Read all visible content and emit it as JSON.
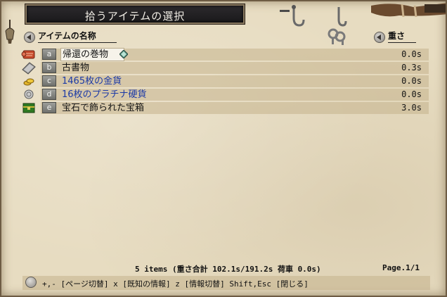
{
  "window": {
    "title": "拾うアイテムの選択"
  },
  "header": {
    "name_label": "アイテムの名称",
    "weight_label": "重さ"
  },
  "items": [
    {
      "key": "a",
      "name": "帰還の巻物",
      "weight": "0.0s",
      "color": "#141414",
      "icon": "scroll-icon",
      "selected": true
    },
    {
      "key": "b",
      "name": "古書物",
      "weight": "0.3s",
      "color": "#141414",
      "icon": "book-icon",
      "selected": false
    },
    {
      "key": "c",
      "name": "1465枚の金貨",
      "weight": "0.0s",
      "color": "#1c3aa6",
      "icon": "gold-coins-icon",
      "selected": false
    },
    {
      "key": "d",
      "name": "16枚のプラチナ硬貨",
      "weight": "0.0s",
      "color": "#1c3aa6",
      "icon": "platinum-coin-icon",
      "selected": false
    },
    {
      "key": "e",
      "name": "宝石で飾られた宝箱",
      "weight": "3.0s",
      "color": "#141414",
      "icon": "treasure-chest-icon",
      "selected": false
    }
  ],
  "footer": {
    "summary": "5 items  (重さ合計 102.1s/191.2s  荷車 0.0s)",
    "page": "Page.1/1",
    "help": "+,- [ページ切替]  x [既知の情報]  z [情報切替]  Shift,Esc [閉じる]"
  }
}
